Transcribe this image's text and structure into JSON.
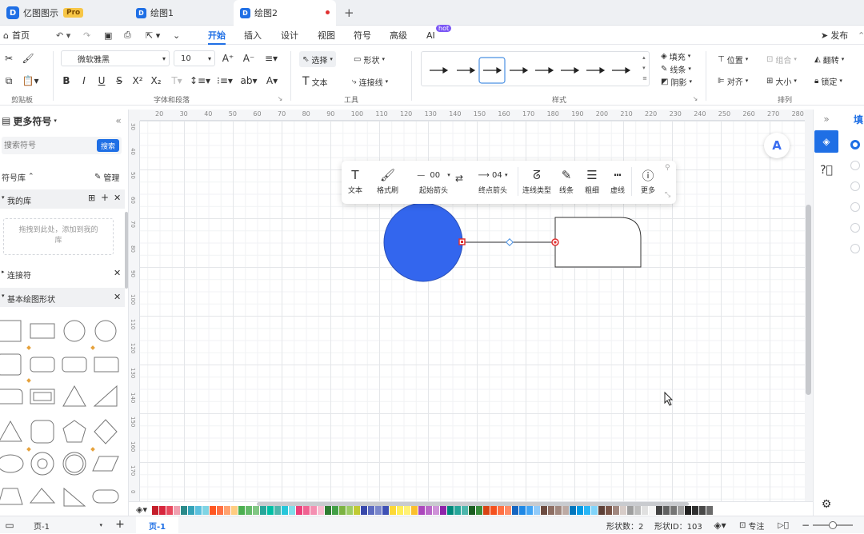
{
  "app": {
    "name": "亿图图示",
    "badge": "Pro",
    "tabs": [
      {
        "label": "绘图1"
      },
      {
        "label": "绘图2"
      }
    ],
    "new_tab": "+"
  },
  "menu": {
    "home": "首页",
    "items": [
      "开始",
      "插入",
      "设计",
      "视图",
      "符号",
      "高级",
      "AI"
    ],
    "ai_badge": "hot",
    "publish": "发布"
  },
  "ribbon": {
    "clipboard_label": "剪贴板",
    "font_name": "微软雅黑",
    "font_size": "10",
    "font_label": "字体和段落",
    "select": "选择",
    "shape": "形状",
    "text": "文本",
    "connector": "连接线",
    "tools_label": "工具",
    "style_label": "样式",
    "fill": "填充",
    "line": "线条",
    "shadow": "阴影",
    "position": "位置",
    "group": "组合",
    "flip": "翻转",
    "align": "对齐",
    "size": "大小",
    "lock": "锁定",
    "arrange_label": "排列"
  },
  "sidebar": {
    "title": "更多符号",
    "search_placeholder": "搜索符号",
    "search_btn": "搜索",
    "library": "符号库",
    "manage": "管理",
    "my_lib": "我的库",
    "drop_hint": "拖拽到此处，添加到我的库",
    "connectors": "连接符",
    "basic_shapes": "基本绘图形状"
  },
  "ruler": {
    "h": [
      "20",
      "30",
      "40",
      "50",
      "60",
      "70",
      "80",
      "90",
      "100",
      "110",
      "120",
      "130",
      "140",
      "150",
      "160",
      "170",
      "180",
      "190",
      "200",
      "210",
      "220",
      "230",
      "240",
      "250",
      "260",
      "270",
      "280"
    ],
    "v": [
      "30",
      "40",
      "50",
      "60",
      "70",
      "80",
      "90",
      "100",
      "110",
      "120",
      "130",
      "140",
      "150",
      "160",
      "170",
      "0"
    ]
  },
  "context_toolbar": {
    "text": "文本",
    "format_painter": "格式刷",
    "start_value": "00",
    "start_label": "起始箭头",
    "end_value": "04",
    "end_label": "终点箭头",
    "conn_type": "连线类型",
    "line": "线条",
    "weight": "粗细",
    "dash": "虚线",
    "more": "更多"
  },
  "right_panel": {
    "title": "填"
  },
  "colors": {
    "accent": "#1f6fe5",
    "circle_fill": "#3366ee",
    "selection": "#e03030"
  },
  "palette": [
    "#c41e2a",
    "#d7263d",
    "#e84a5f",
    "#f0a0b0",
    "#2a8a8a",
    "#34a3b8",
    "#5bc0de",
    "#7fd4e4",
    "#ff5722",
    "#ff7043",
    "#ffa270",
    "#ffcc80",
    "#4caf50",
    "#66bb6a",
    "#81c784",
    "#26a69a",
    "#00bfa5",
    "#4db6ac",
    "#26c6da",
    "#80deea",
    "#ec407a",
    "#f06292",
    "#f48fb1",
    "#f8bbd0",
    "#2e7d32",
    "#43a047",
    "#7cb342",
    "#9ccc65",
    "#c0ca33",
    "#3949ab",
    "#5c6bc0",
    "#7986cb",
    "#3f51b5",
    "#fdd835",
    "#ffee58",
    "#fff176",
    "#fbc02d",
    "#ab47bc",
    "#ba68c8",
    "#ce93d8",
    "#8e24aa",
    "#00897b",
    "#26a69a",
    "#4db6ac",
    "#1b5e20",
    "#388e3c",
    "#d84315",
    "#f4511e",
    "#ff7043",
    "#ff8a65",
    "#1565c0",
    "#1e88e5",
    "#42a5f5",
    "#90caf9",
    "#6d4c41",
    "#8d6e63",
    "#a1887f",
    "#bcaaa4",
    "#0277bd",
    "#039be5",
    "#29b6f6",
    "#81d4fa",
    "#5d4037",
    "#795548",
    "#a1887f",
    "#d7ccc8",
    "#9e9e9e",
    "#bdbdbd",
    "#e0e0e0",
    "#f5f5f5",
    "#424242",
    "#616161",
    "#757575",
    "#9e9e9e",
    "#212121",
    "#303030",
    "#484848",
    "#6b6b6b"
  ],
  "status": {
    "page_selector": "页-1",
    "current_page": "页-1",
    "shape_count": "形状数：2",
    "shape_id": "形状ID：103",
    "focus": "专注"
  }
}
